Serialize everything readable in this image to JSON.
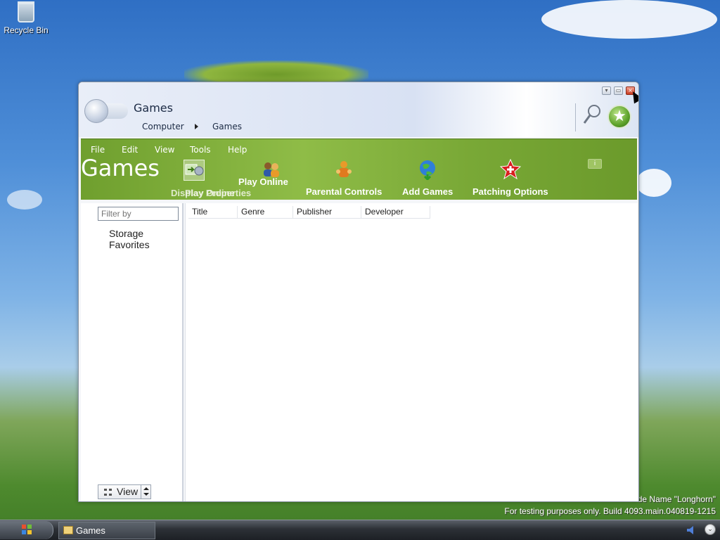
{
  "desktop": {
    "icons": [
      {
        "label": "Recycle Bin",
        "icon": "recycle-bin-icon"
      }
    ],
    "watermark_line1": "de Name \"Longhorn\"",
    "watermark_line2": "For testing purposes only. Build 4093.main.040819-1215"
  },
  "window": {
    "title": "Games",
    "breadcrumb": [
      "Computer",
      "Games"
    ],
    "controls": {
      "minimize": "minimize-button",
      "maximize": "maximize-button",
      "close": "close-button"
    }
  },
  "menu": [
    "File",
    "Edit",
    "View",
    "Tools",
    "Help"
  ],
  "banner": {
    "title": "Games",
    "tasks": [
      {
        "label": "Play Online",
        "icon": "people-icon"
      },
      {
        "label": "Parental Controls",
        "icon": "parental-icon"
      },
      {
        "label": "Add Games",
        "icon": "globe-icon"
      },
      {
        "label": "Patching Options",
        "icon": "patch-star-icon"
      }
    ],
    "overlapping_labels": [
      "Display Properties",
      "Play Online"
    ]
  },
  "left_pane": {
    "filter_placeholder": "Filter by",
    "favorites": [
      "Storage Favorites"
    ],
    "view_button": "View"
  },
  "columns": [
    "Title",
    "Genre",
    "Publisher",
    "Developer"
  ],
  "taskbar": {
    "items": [
      {
        "label": "Games",
        "icon": "games-folder-icon"
      }
    ]
  },
  "colors": {
    "banner_green": "#8fbc47",
    "taskbar": "#2c3036",
    "window_frame": "#e9eef8"
  }
}
